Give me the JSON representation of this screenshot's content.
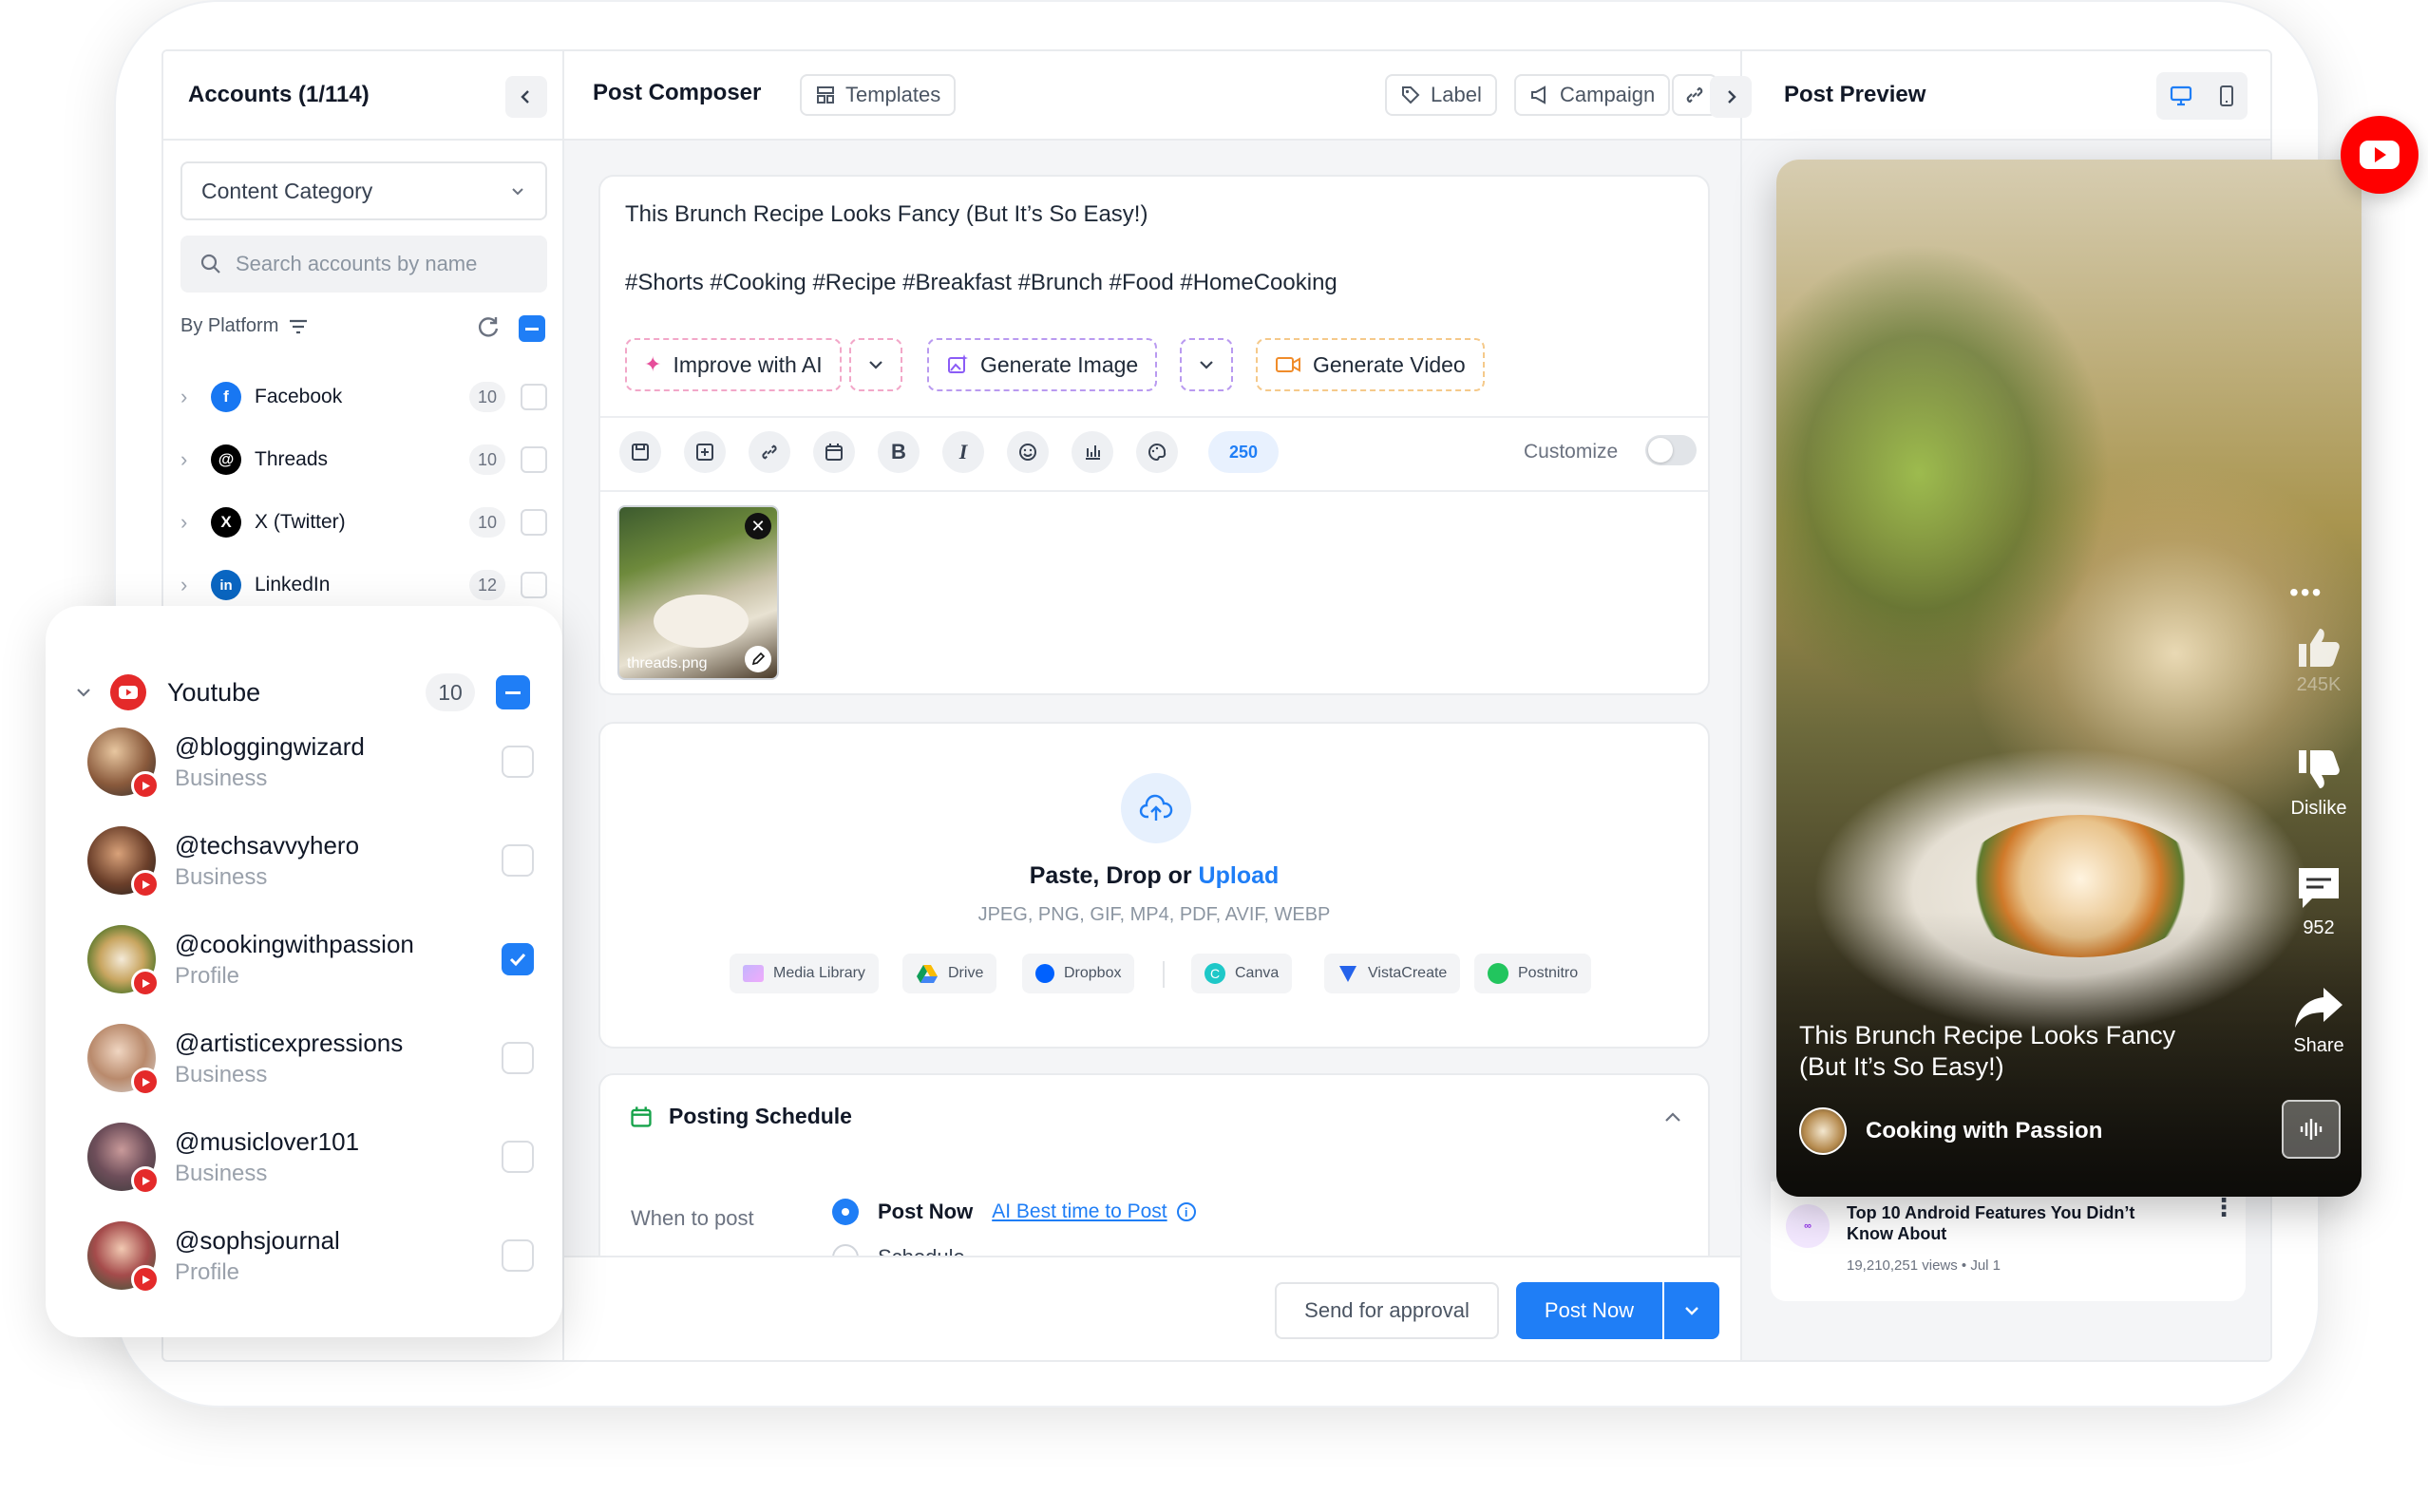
{
  "accounts": {
    "title": "Accounts (1/114)",
    "category_select": "Content Category",
    "search_placeholder": "Search accounts by name",
    "by_platform": "By Platform",
    "platforms": [
      {
        "name": "Facebook",
        "count": "10",
        "color": "#1877f2"
      },
      {
        "name": "Threads",
        "count": "10",
        "color": "#000000"
      },
      {
        "name": "X (Twitter)",
        "count": "10",
        "color": "#000000"
      },
      {
        "name": "LinkedIn",
        "count": "12",
        "color": "#0a66c2"
      }
    ]
  },
  "youtube_card": {
    "platform": "Youtube",
    "count": "10",
    "accounts": [
      {
        "handle": "@bloggingwizard",
        "type": "Business",
        "checked": false
      },
      {
        "handle": "@techsavvyhero",
        "type": "Business",
        "checked": false
      },
      {
        "handle": "@cookingwithpassion",
        "type": "Profile",
        "checked": true
      },
      {
        "handle": "@artisticexpressions",
        "type": "Business",
        "checked": false
      },
      {
        "handle": "@musiclover101",
        "type": "Business",
        "checked": false
      },
      {
        "handle": "@sophsjournal",
        "type": "Profile",
        "checked": false
      }
    ]
  },
  "composer": {
    "title": "Post Composer",
    "templates": "Templates",
    "label": "Label",
    "campaign": "Campaign",
    "post_title": "This Brunch Recipe Looks Fancy (But It’s So Easy!)",
    "hashtags": "#Shorts #Cooking #Recipe #Breakfast #Brunch #Food #HomeCooking",
    "improve_ai": "Improve with AI",
    "generate_image": "Generate Image",
    "generate_video": "Generate Video",
    "char_count": "250",
    "customize": "Customize",
    "attachment_name": "threads.png",
    "upload_title_prefix": "Paste, Drop or",
    "upload_link": "Upload",
    "formats": "JPEG, PNG, GIF, MP4, PDF, AVIF, WEBP",
    "sources": [
      "Media Library",
      "Drive",
      "Dropbox",
      "Canva",
      "VistaCreate",
      "Postnitro"
    ]
  },
  "schedule": {
    "title": "Posting Schedule",
    "when_label": "When to post",
    "post_now": "Post Now",
    "ai_best": "AI Best time to Post",
    "schedule": "Schedule"
  },
  "footer": {
    "send_approval": "Send for approval",
    "post_now": "Post Now"
  },
  "preview": {
    "title": "Post Preview",
    "caption": "This Brunch Recipe Looks Fancy (But It’s So Easy!)",
    "channel": "Cooking with Passion",
    "likes": "245K",
    "dislike": "Dislike",
    "comments": "952",
    "share": "Share",
    "below_title": "Top 10 Android Features You Didn’t Know About",
    "below_meta": "19,210,251 views • Jul 1"
  },
  "colors": {
    "accent": "#1f7ef6",
    "youtube_red": "#e42a2a"
  }
}
